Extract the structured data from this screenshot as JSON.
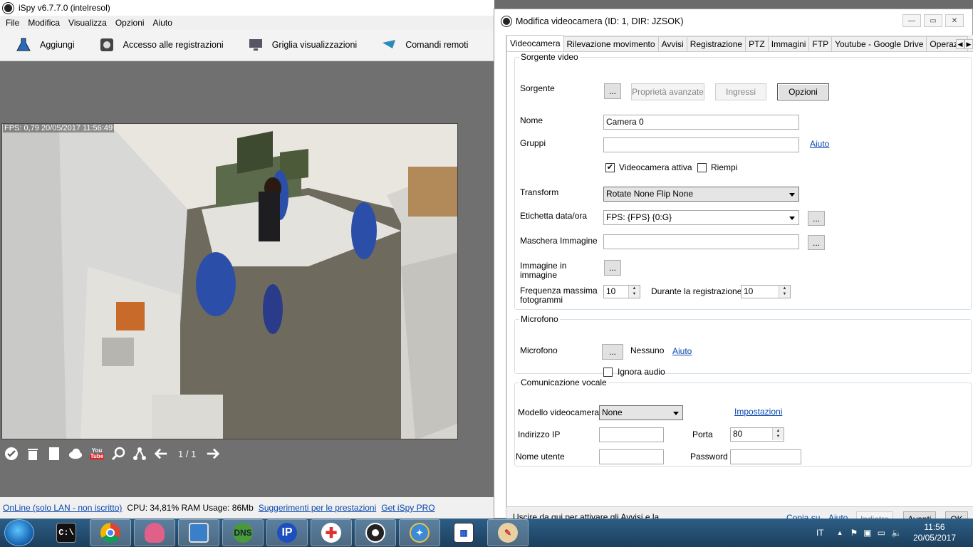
{
  "main_window": {
    "title": "iSpy v6.7.7.0 (intelresol)",
    "menu": [
      "File",
      "Modifica",
      "Visualizza",
      "Opzioni",
      "Aiuto"
    ],
    "toolbar": [
      "Aggiungi",
      "Accesso alle registrazioni",
      "Griglia visualizzazioni",
      "Comandi remoti"
    ],
    "camera_overlay": "FPS: 0,79 20/05/2017 11:56:49",
    "page_indicator": "1 / 1",
    "status": {
      "online_link": "OnLine (solo LAN - non iscritto)",
      "cpu": "CPU: 34,81% RAM Usage: 86Mb",
      "perf_link": "Suggerimenti per le prestazioni",
      "pro_link": "Get iSpy PRO"
    }
  },
  "dialog": {
    "title": "Modifica videocamera (ID: 1, DIR: JZSOK)",
    "tabs": [
      "Videocamera",
      "Rilevazione movimento",
      "Avvisi",
      "Registrazione",
      "PTZ",
      "Immagini",
      "FTP",
      "Youtube - Google Drive",
      "Operazio"
    ],
    "video_source": {
      "legend": "Sorgente video",
      "source_label": "Sorgente",
      "browse": "...",
      "advanced": "Proprietà avanzate",
      "inputs": "Ingressi",
      "options": "Opzioni",
      "name_label": "Nome",
      "name_value": "Camera 0",
      "groups_label": "Gruppi",
      "groups_value": "",
      "help": "Aiuto",
      "active_label": "Videocamera attiva",
      "active_checked": true,
      "fill_label": "Riempi",
      "fill_checked": false,
      "transform_label": "Transform",
      "transform_value": "Rotate None Flip None",
      "timestamp_label": "Etichetta data/ora",
      "timestamp_value": "FPS: {FPS} {0:G}",
      "mask_label": "Maschera Immagine",
      "mask_value": "",
      "pip_label_1": "Immagine in",
      "pip_label_2": "immagine",
      "fps_label_1": "Frequenza massima",
      "fps_label_2": "fotogrammi",
      "fps_value": "10",
      "rec_label": "Durante la registrazione",
      "rec_value": "10"
    },
    "microphone": {
      "legend": "Microfono",
      "label": "Microfono",
      "browse": "...",
      "value": "Nessuno",
      "help": "Aiuto",
      "ignore_label": "Ignora audio",
      "ignore_checked": false
    },
    "voice": {
      "legend": "Comunicazione vocale",
      "model_label": "Modello videocamera",
      "model_value": "None",
      "settings_link": "Impostazioni",
      "ip_label": "Indirizzo IP",
      "ip_value": "",
      "port_label": "Porta",
      "port_value": "80",
      "user_label": "Nome utente",
      "user_value": "",
      "password_label": "Password",
      "password_value": ""
    },
    "footer": {
      "note": "Uscire da qui per attivare gli Avvisi e la",
      "copy_link": "Copia su",
      "help_link": "Aiuto",
      "back": "Indietro",
      "next": "Avanti",
      "ok": "OK"
    }
  },
  "taskbar": {
    "language": "IT",
    "time": "11:56",
    "date": "20/05/2017"
  }
}
